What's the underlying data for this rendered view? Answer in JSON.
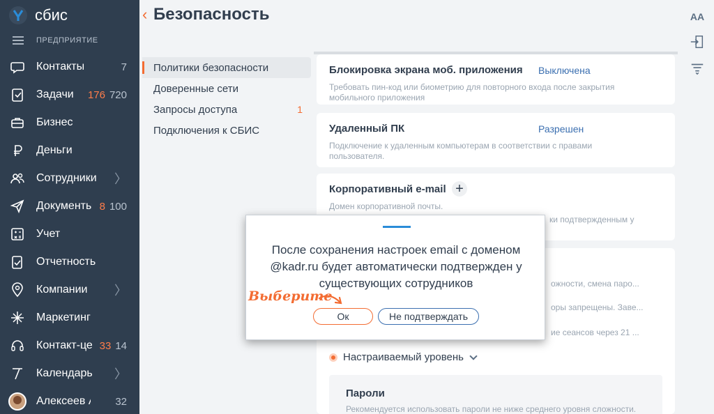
{
  "app": {
    "logo_text": "сбис",
    "company_label": "ПРЕДПРИЯТИЕ"
  },
  "nav": [
    {
      "label": "Контакты",
      "icon": "chat-icon",
      "total": "7"
    },
    {
      "label": "Задачи",
      "icon": "tasks-icon",
      "new": "176",
      "total": "720"
    },
    {
      "label": "Бизнес",
      "icon": "briefcase-icon"
    },
    {
      "label": "Деньги",
      "icon": "ruble-icon"
    },
    {
      "label": "Сотрудники",
      "icon": "people-icon",
      "chevron": true
    },
    {
      "label": "Документы",
      "icon": "send-icon",
      "new": "8",
      "total": "100"
    },
    {
      "label": "Учет",
      "icon": "calculator-icon"
    },
    {
      "label": "Отчетность",
      "icon": "report-icon"
    },
    {
      "label": "Компании",
      "icon": "location-icon",
      "chevron": true
    },
    {
      "label": "Маркетинг",
      "icon": "sparkle-icon"
    },
    {
      "label": "Контакт-центр",
      "icon": "headset-icon",
      "new": "33",
      "total": "14"
    },
    {
      "label": "Календарь",
      "icon": "calendar-icon",
      "chevron": true
    },
    {
      "label": "Алексеев А.А.",
      "icon": "avatar",
      "total": "32"
    }
  ],
  "header": {
    "title": "Безопасность"
  },
  "toolbar": {
    "font_size_label": "AA"
  },
  "subnav": [
    {
      "label": "Политики безопасности",
      "active": true
    },
    {
      "label": "Доверенные сети"
    },
    {
      "label": "Запросы доступа",
      "count": "1"
    },
    {
      "label": "Подключения к СБИС"
    }
  ],
  "cards": {
    "lock": {
      "title": "Блокировка экрана моб. приложения",
      "value": "Выключена",
      "desc": "Требовать пин-код или биометрию для повторного входа после закрытия мобильного приложения"
    },
    "remote": {
      "title": "Удаленный ПК",
      "value": "Разрешен",
      "desc": "Подключение к удаленным компьютерам в соответствии с правами пользователя."
    },
    "email": {
      "title": "Корпоративный e-mail",
      "desc": "Домен корпоративной почты.",
      "desc_cut": "ки подтвержденным у"
    },
    "policy_rows": [
      "ожности, смена паро...",
      "оры запрещены. Заве...",
      "ие сеансов через 21 ..."
    ],
    "level": "Настраиваемый уровень",
    "passwords": {
      "title": "Пароли",
      "desc": "Рекомендуется использовать пароли не ниже среднего уровня сложности."
    }
  },
  "dialog": {
    "message": "После сохранения настроек email с доменом @kadr.ru будет автоматически подтвержден у существующих сотрудников",
    "ok_label": "Ок",
    "cancel_label": "Не подтверждать"
  },
  "hint": {
    "text": "Выберите"
  },
  "colors": {
    "sidebar": "#2f3e4f",
    "accent": "#f36c32",
    "link": "#3b6fb0"
  }
}
